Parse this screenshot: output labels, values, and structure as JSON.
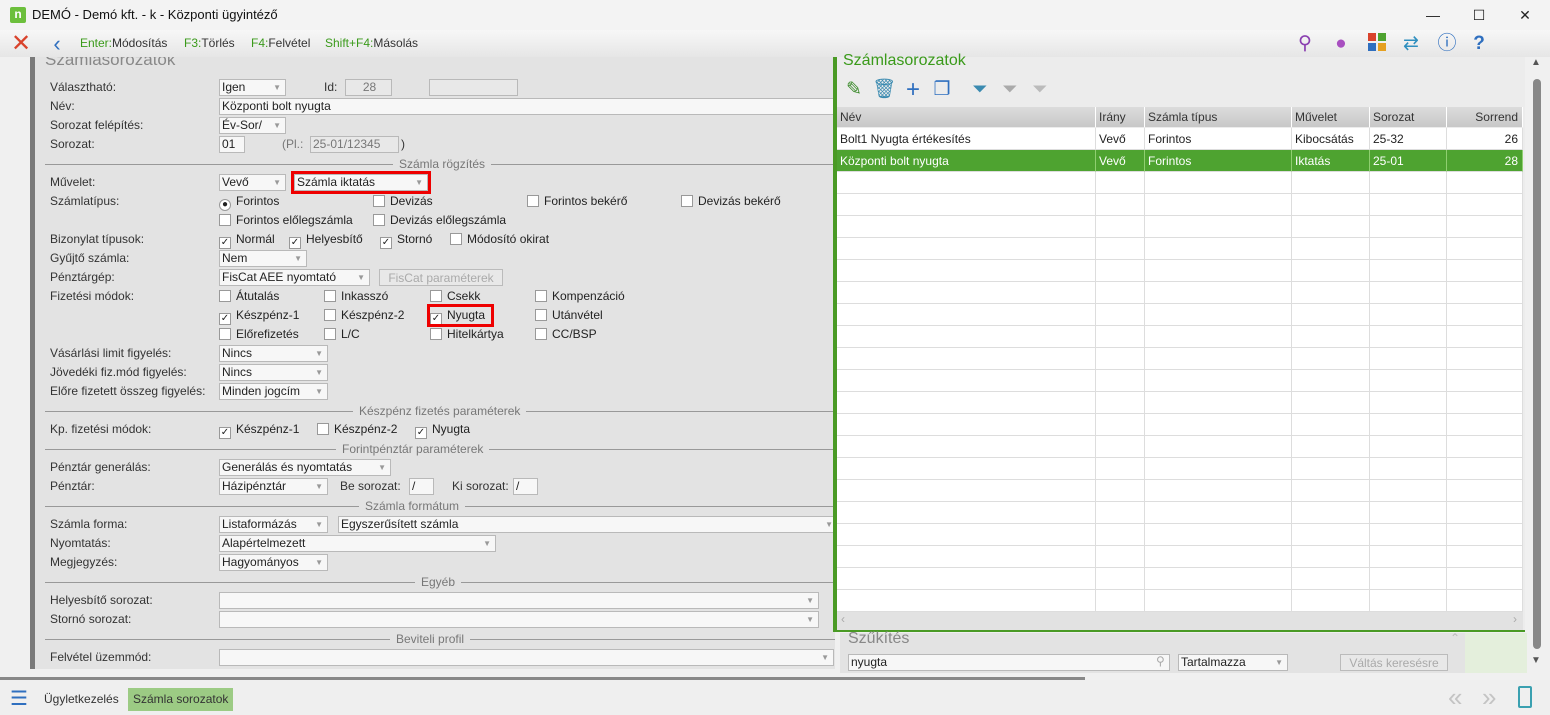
{
  "window": {
    "title": "DEMÓ - Demó kft. - k - Központi ügyintéző",
    "logo": "n",
    "minimize": "—",
    "maximize": "☐",
    "close": "✕"
  },
  "toolbar": {
    "shortcuts": [
      {
        "key": "Enter:",
        "label": "Módosítás"
      },
      {
        "key": "F3:",
        "label": "Törlés"
      },
      {
        "key": "F4:",
        "label": "Felvétel"
      },
      {
        "key": "Shift+F4:",
        "label": "Másolás"
      }
    ],
    "icons": [
      "search-icon",
      "user-icon",
      "apps-icon",
      "swap-icon",
      "info-icon",
      "help-icon"
    ]
  },
  "form": {
    "title": "Számlasorozatok",
    "valaszthato": {
      "label": "Választható:",
      "value": "Igen"
    },
    "id": {
      "label": "Id:",
      "value": "28"
    },
    "nev": {
      "label": "Név:",
      "value": "Központi bolt nyugta"
    },
    "felepites": {
      "label": "Sorozat felépítés:",
      "value": "Év-Sor/"
    },
    "sorozat": {
      "label": "Sorozat:",
      "value": "01",
      "pl_label": "(Pl.:",
      "pl_value": "25-01/12345",
      "close": ")"
    },
    "sec_rogzites": "Számla rögzítés",
    "muvelet": {
      "label": "Művelet:",
      "value1": "Vevő",
      "value2": "Számla iktatás"
    },
    "szamlatipus": {
      "label": "Számlatípus:",
      "options": [
        {
          "label": "Forintos",
          "checked": true
        },
        {
          "label": "Devizás",
          "checked": false
        },
        {
          "label": "Forintos bekérő",
          "checked": false
        },
        {
          "label": "Devizás bekérő",
          "checked": false
        },
        {
          "label": "Forintos előlegszámla",
          "checked": false
        },
        {
          "label": "Devizás előlegszámla",
          "checked": false
        }
      ]
    },
    "bizonylat": {
      "label": "Bizonylat típusok:",
      "options": [
        {
          "label": "Normál",
          "checked": true
        },
        {
          "label": "Helyesbítő",
          "checked": true
        },
        {
          "label": "Stornó",
          "checked": true
        },
        {
          "label": "Módosító okirat",
          "checked": false
        }
      ]
    },
    "gyujto": {
      "label": "Gyűjtő számla:",
      "value": "Nem"
    },
    "penztargep": {
      "label": "Pénztárgép:",
      "value": "FisCat AEE nyomtató",
      "button": "FisCat paraméterek"
    },
    "fizetesi": {
      "label": "Fizetési módok:",
      "options": [
        {
          "label": "Átutalás",
          "checked": false
        },
        {
          "label": "Inkasszó",
          "checked": false
        },
        {
          "label": "Csekk",
          "checked": false
        },
        {
          "label": "Kompenzáció",
          "checked": false
        },
        {
          "label": "Készpénz-1",
          "checked": true
        },
        {
          "label": "Készpénz-2",
          "checked": false
        },
        {
          "label": "Nyugta",
          "checked": true
        },
        {
          "label": "Utánvétel",
          "checked": false
        },
        {
          "label": "Előrefizetés",
          "checked": false
        },
        {
          "label": "L/C",
          "checked": false
        },
        {
          "label": "Hitelkártya",
          "checked": false
        },
        {
          "label": "CC/BSP",
          "checked": false
        }
      ]
    },
    "vasarlasi": {
      "label": "Vásárlási limit figyelés:",
      "value": "Nincs"
    },
    "jovedeki": {
      "label": "Jövedéki fiz.mód figyelés:",
      "value": "Nincs"
    },
    "elore": {
      "label": "Előre fizetett összeg figyelés:",
      "value": "Minden jogcím"
    },
    "sec_keszpenz": "Készpénz fizetés paraméterek",
    "kp": {
      "label": "Kp. fizetési módok:",
      "options": [
        {
          "label": "Készpénz-1",
          "checked": true
        },
        {
          "label": "Készpénz-2",
          "checked": false
        },
        {
          "label": "Nyugta",
          "checked": true
        }
      ]
    },
    "sec_forint": "Forintpénztár paraméterek",
    "pgen": {
      "label": "Pénztár generálás:",
      "value": "Generálás és nyomtatás"
    },
    "penztar": {
      "label": "Pénztár:",
      "value": "Házipénztár",
      "be_label": "Be sorozat:",
      "be_value": "/",
      "ki_label": "Ki sorozat:",
      "ki_value": "/"
    },
    "sec_format": "Számla formátum",
    "forma": {
      "label": "Számla forma:",
      "value1": "Listaformázás",
      "value2": "Egyszerűsített számla"
    },
    "nyomtatas": {
      "label": "Nyomtatás:",
      "value": "Alapértelmezett"
    },
    "megjegyzes": {
      "label": "Megjegyzés:",
      "value": "Hagyományos"
    },
    "sec_egyeb": "Egyéb",
    "helyesbito": {
      "label": "Helyesbítő sorozat:",
      "value": ""
    },
    "storno": {
      "label": "Stornó sorozat:",
      "value": ""
    },
    "sec_profil": "Beviteli profil",
    "felvetel": {
      "label": "Felvétel üzemmód:",
      "value": ""
    }
  },
  "list": {
    "title": "Számlasorozatok",
    "icons": [
      "edit-icon",
      "delete-icon",
      "add-icon",
      "copy-icon",
      "filter-icon",
      "clear-filter-icon",
      "add-filter-icon"
    ],
    "columns": [
      "Név",
      "Irány",
      "Számla típus",
      "Művelet",
      "Sorozat",
      "Sorrend"
    ],
    "rows": [
      [
        "Bolt1 Nyugta értékesítés",
        "Vevő",
        "Forintos",
        "Kibocsátás",
        "25-32",
        "26"
      ],
      [
        "Központi bolt nyugta",
        "Vevő",
        "Forintos",
        "Iktatás",
        "25-01",
        "28"
      ]
    ],
    "selected_row": 1
  },
  "filter": {
    "title": "Szűkítés",
    "search": "nyugta",
    "mode": "Tartalmazza",
    "button": "Váltás keresésre"
  },
  "bottom": {
    "tabs": [
      "Ügyletkezelés",
      "Számla sorozatok"
    ],
    "active_tab": 1
  },
  "colors": {
    "accent": "#4ea330",
    "highlight": "#e00000"
  }
}
